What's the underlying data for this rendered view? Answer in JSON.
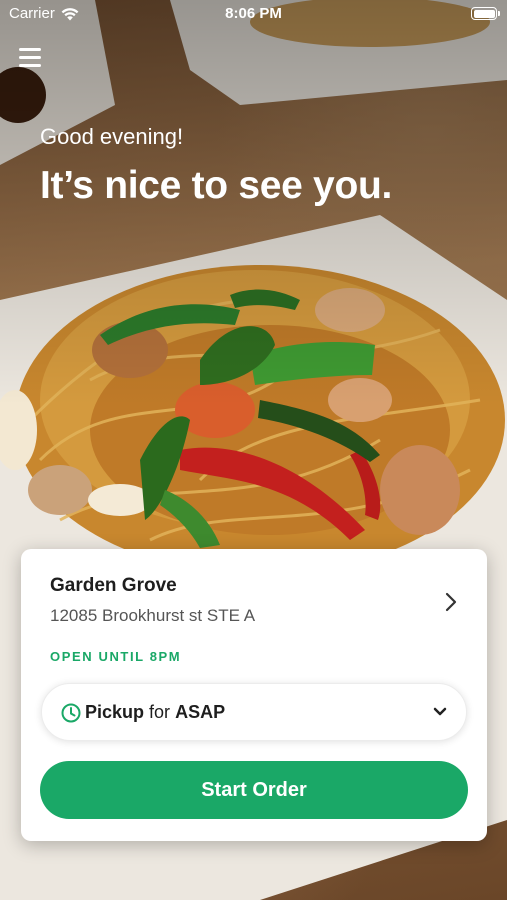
{
  "status_bar": {
    "carrier": "Carrier",
    "time": "8:06 PM"
  },
  "header": {
    "menu_icon": "hamburger-menu-icon",
    "greeting": "Good evening!",
    "headline": "It’s nice to see you."
  },
  "store": {
    "name": "Garden Grove",
    "address": "12085 Brookhurst st STE A",
    "status": "OPEN UNTIL 8PM"
  },
  "order_mode": {
    "mode": "Pickup",
    "connector": "for",
    "time": "ASAP"
  },
  "actions": {
    "start_order": "Start Order"
  },
  "colors": {
    "accent": "#1aa867",
    "card_background": "#ffffff",
    "text_primary": "#1e1e1e"
  }
}
